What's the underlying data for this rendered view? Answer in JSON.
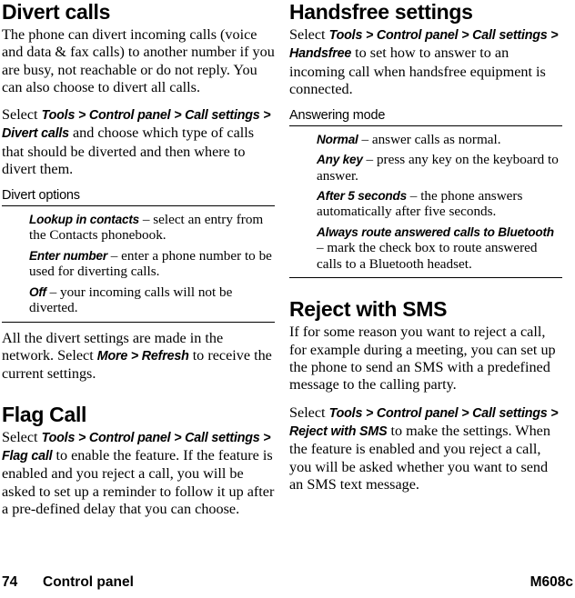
{
  "document": {
    "type": "user-manual-page",
    "page_number": "74",
    "chapter": "Control panel",
    "model": "M608c"
  },
  "left_column": {
    "heading": "Divert calls",
    "para1": "The phone can divert incoming calls (voice and data & fax calls) to another number if you are busy, not reachable or do not reply. You can also choose to divert all calls.",
    "para2": {
      "lead": "Select ",
      "ui_path": "Tools > Control panel > Call settings > Divert calls",
      "tail": " and choose which type of calls that should be diverted and then where to divert them."
    },
    "options_subhead": "Divert options",
    "options": [
      {
        "term": "Lookup in contacts",
        "desc": " – select an entry from the Contacts phonebook."
      },
      {
        "term": "Enter number",
        "desc": " – enter a phone number to be used for diverting calls."
      },
      {
        "term": "Off",
        "desc": " – your incoming calls will not be diverted."
      }
    ],
    "para3": {
      "lead": "All the divert settings are made in the network. Select ",
      "ui_path": "More > Refresh",
      "tail": " to receive the current settings."
    },
    "heading2": "Flag Call",
    "para4": {
      "lead": "Select ",
      "ui_path": "Tools > Control panel > Call settings > Flag call",
      "tail": " to enable the feature. If the feature is enabled and you reject a call, you will be asked to set up a reminder to follow it up after a pre-defined delay that you can choose."
    }
  },
  "right_column": {
    "heading": "Handsfree settings",
    "para1": {
      "lead": "Select ",
      "ui_path": "Tools > Control panel > Call settings > Handsfree",
      "tail": " to set how to answer to an incoming call when handsfree equipment is connected."
    },
    "options_subhead": "Answering mode",
    "options": [
      {
        "term": "Normal",
        "desc": " – answer calls as normal."
      },
      {
        "term": "Any key",
        "desc": " – press any key on the keyboard to answer."
      },
      {
        "term": "After 5 seconds",
        "desc": " – the phone answers automatically after five seconds."
      },
      {
        "term": "Always route answered calls to Bluetooth",
        "desc": " – mark the check box to route answered calls to a Bluetooth headset."
      }
    ],
    "heading2": "Reject with SMS",
    "para2": "If for some reason you want to reject a call, for example during a meeting, you can set up the phone to send an SMS with a predefined message to the calling party.",
    "para3": {
      "lead": "Select ",
      "ui_path": "Tools > Control panel > Call settings > Reject with SMS",
      "tail": " to make the settings. When the feature is enabled and you reject a call, you will be asked whether you want to send an SMS text message."
    }
  }
}
